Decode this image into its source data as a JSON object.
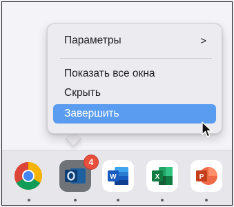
{
  "context_menu": {
    "items": [
      {
        "label": "Параметры",
        "has_submenu": true
      },
      {
        "label": "Показать все окна"
      },
      {
        "label": "Скрыть"
      },
      {
        "label": "Завершить",
        "highlighted": true
      }
    ],
    "submenu_glyph": ">",
    "highlight_color": "#5a9cf0"
  },
  "dock": {
    "apps": [
      {
        "name": "Google Chrome",
        "icon": "chrome-icon",
        "running": true
      },
      {
        "name": "Microsoft Outlook",
        "icon": "outlook-icon",
        "running": true,
        "badge": "4"
      },
      {
        "name": "Microsoft Word",
        "icon": "word-icon",
        "running": true
      },
      {
        "name": "Microsoft Excel",
        "icon": "excel-icon",
        "running": true
      },
      {
        "name": "Microsoft PowerPoint",
        "icon": "powerpoint-icon",
        "running": true
      }
    ]
  }
}
